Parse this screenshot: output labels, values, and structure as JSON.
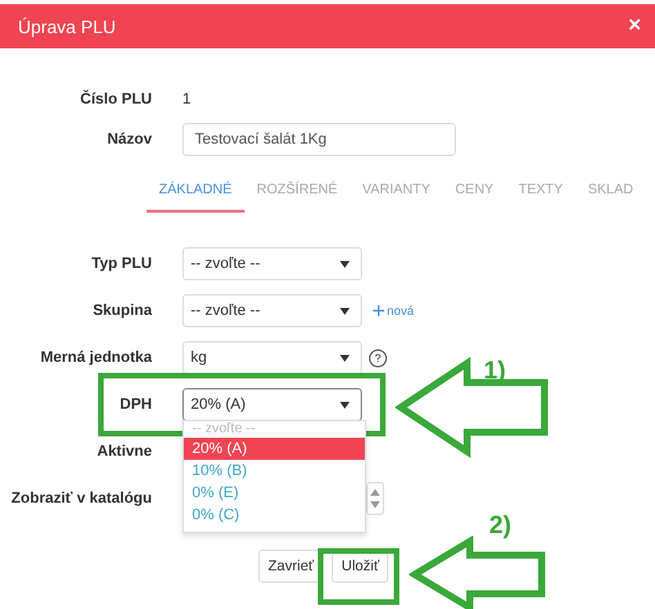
{
  "window": {
    "title": "Úprava PLU",
    "close": "×"
  },
  "info": [
    {
      "label": "Číslo PLU",
      "value": "1"
    }
  ],
  "name_field": {
    "label": "Názov",
    "value": "Testovací šalát 1Kg"
  },
  "tabs": [
    {
      "label": "ZÁKLADNÉ",
      "selected": true
    },
    {
      "label": "ROZŠÍRENÉ",
      "selected": false
    },
    {
      "label": "VARIANTY",
      "selected": false
    },
    {
      "label": "CENY",
      "selected": false
    },
    {
      "label": "TEXTY",
      "selected": false
    },
    {
      "label": "SKLAD",
      "selected": false
    }
  ],
  "fields": [
    {
      "kind": "select",
      "label": "Typ PLU",
      "value": "-- zvoľte --"
    },
    {
      "kind": "select",
      "label": "Skupina",
      "value": "-- zvoľte --",
      "link": "nová"
    },
    {
      "kind": "select",
      "label": "Merná jednotka",
      "value": "kg",
      "help": "?"
    },
    {
      "kind": "select",
      "label": "DPH",
      "value": "20% (A)",
      "focused": true
    },
    {
      "kind": "label",
      "label": "Aktivne"
    },
    {
      "kind": "spinner",
      "label": "Zobraziť v katalógu"
    }
  ],
  "dropdown": {
    "options": [
      {
        "label": "-- zvoľte --",
        "selected": false,
        "kind": "placeholder"
      },
      {
        "label": "20% (A)",
        "selected": true,
        "kind": "option"
      },
      {
        "label": "10% (B)",
        "selected": false,
        "kind": "option"
      },
      {
        "label": "0% (E)",
        "selected": false,
        "kind": "option"
      },
      {
        "label": "0% (C)",
        "selected": false,
        "kind": "option"
      }
    ]
  },
  "buttons": [
    "Zavrieť",
    "Uložiť"
  ],
  "annotations": [
    "1)",
    "2)"
  ]
}
